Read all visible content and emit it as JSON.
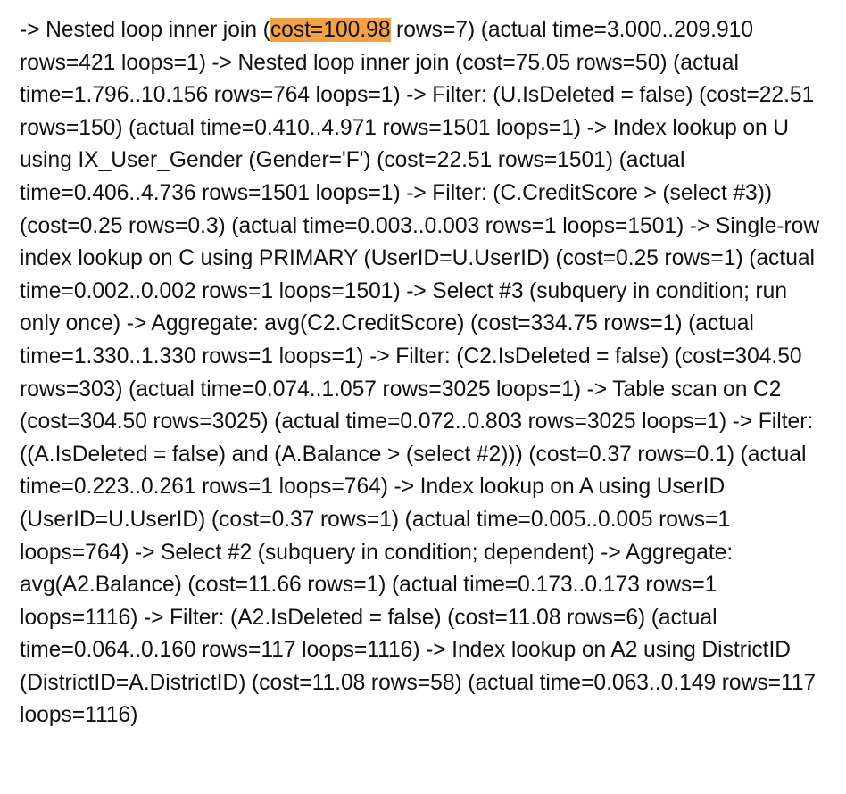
{
  "document": {
    "text_before": "-> Nested loop inner join (",
    "highlighted": "cost=100.98",
    "text_after": " rows=7) (actual time=3.000..209.910 rows=421 loops=1) -> Nested loop inner join (cost=75.05 rows=50) (actual time=1.796..10.156 rows=764 loops=1) -> Filter: (U.IsDeleted = false) (cost=22.51 rows=150) (actual time=0.410..4.971 rows=1501 loops=1) -> Index lookup on U using IX_User_Gender (Gender='F') (cost=22.51 rows=1501) (actual time=0.406..4.736 rows=1501 loops=1) -> Filter: (C.CreditScore > (select #3)) (cost=0.25 rows=0.3) (actual time=0.003..0.003 rows=1 loops=1501) -> Single-row index lookup on C using PRIMARY (UserID=U.UserID) (cost=0.25 rows=1) (actual time=0.002..0.002 rows=1 loops=1501) -> Select #3 (subquery in condition; run only once) -> Aggregate: avg(C2.CreditScore) (cost=334.75 rows=1) (actual time=1.330..1.330 rows=1 loops=1) -> Filter: (C2.IsDeleted = false) (cost=304.50 rows=303) (actual time=0.074..1.057 rows=3025 loops=1) -> Table scan on C2 (cost=304.50 rows=3025) (actual time=0.072..0.803 rows=3025 loops=1) -> Filter: ((A.IsDeleted = false) and (A.Balance > (select #2))) (cost=0.37 rows=0.1) (actual time=0.223..0.261 rows=1 loops=764) -> Index lookup on A using UserID (UserID=U.UserID) (cost=0.37 rows=1) (actual time=0.005..0.005 rows=1 loops=764) -> Select #2 (subquery in condition; dependent) -> Aggregate: avg(A2.Balance) (cost=11.66 rows=1) (actual time=0.173..0.173 rows=1 loops=1116) -> Filter: (A2.IsDeleted = false) (cost=11.08 rows=6) (actual time=0.064..0.160 rows=117 loops=1116) -> Index lookup on A2 using DistrictID (DistrictID=A.DistrictID) (cost=11.08 rows=58) (actual time=0.063..0.149 rows=117 loops=1116)"
  },
  "colors": {
    "highlight": "#f4a13f",
    "text": "#111111",
    "background": "#ffffff"
  }
}
